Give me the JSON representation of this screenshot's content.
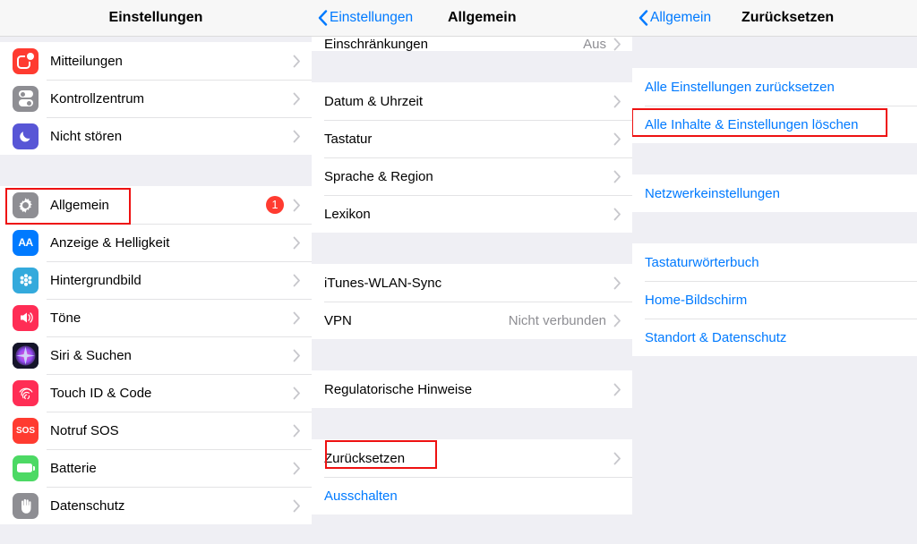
{
  "panels": {
    "settings": {
      "nav": {
        "title": "Einstellungen"
      },
      "groups": [
        {
          "rows": [
            {
              "label": "Mitteilungen",
              "icon": "notifications-icon",
              "chevron": true
            },
            {
              "label": "Kontrollzentrum",
              "icon": "control-center-icon",
              "chevron": true
            },
            {
              "label": "Nicht stören",
              "icon": "do-not-disturb-icon",
              "chevron": true
            }
          ]
        },
        {
          "rows": [
            {
              "label": "Allgemein",
              "icon": "general-gear-icon",
              "badge": "1",
              "chevron": true,
              "highlight": true
            },
            {
              "label": "Anzeige & Helligkeit",
              "icon": "display-brightness-icon",
              "chevron": true
            },
            {
              "label": "Hintergrundbild",
              "icon": "wallpaper-icon",
              "chevron": true
            },
            {
              "label": "Töne",
              "icon": "sounds-icon",
              "chevron": true
            },
            {
              "label": "Siri & Suchen",
              "icon": "siri-icon",
              "chevron": true
            },
            {
              "label": "Touch ID & Code",
              "icon": "touch-id-icon",
              "chevron": true
            },
            {
              "label": "Notruf SOS",
              "icon": "sos-icon",
              "chevron": true
            },
            {
              "label": "Batterie",
              "icon": "battery-icon",
              "chevron": true
            },
            {
              "label": "Datenschutz",
              "icon": "privacy-hand-icon",
              "chevron": true
            }
          ]
        }
      ]
    },
    "general": {
      "nav": {
        "back": "Einstellungen",
        "title": "Allgemein"
      },
      "partial_row": {
        "label": "Einschränkungen",
        "value": "Aus"
      },
      "groups": [
        {
          "rows": [
            {
              "label": "Datum & Uhrzeit",
              "chevron": true
            },
            {
              "label": "Tastatur",
              "chevron": true
            },
            {
              "label": "Sprache & Region",
              "chevron": true
            },
            {
              "label": "Lexikon",
              "chevron": true
            }
          ]
        },
        {
          "rows": [
            {
              "label": "iTunes-WLAN-Sync",
              "chevron": true
            },
            {
              "label": "VPN",
              "value": "Nicht verbunden",
              "chevron": true
            }
          ]
        },
        {
          "rows": [
            {
              "label": "Regulatorische Hinweise",
              "chevron": true
            }
          ]
        },
        {
          "rows": [
            {
              "label": "Zurücksetzen",
              "chevron": true,
              "highlight": true
            },
            {
              "label": "Ausschalten",
              "blue": true
            }
          ]
        }
      ]
    },
    "reset": {
      "nav": {
        "back": "Allgemein",
        "title": "Zurücksetzen"
      },
      "groups": [
        {
          "rows": [
            {
              "label": "Alle Einstellungen zurücksetzen",
              "blue": true
            },
            {
              "label": "Alle Inhalte & Einstellungen löschen",
              "blue": true,
              "highlight": true
            }
          ]
        },
        {
          "rows": [
            {
              "label": "Netzwerkeinstellungen",
              "blue": true
            }
          ]
        },
        {
          "rows": [
            {
              "label": "Tastaturwörterbuch",
              "blue": true
            },
            {
              "label": "Home-Bildschirm",
              "blue": true
            },
            {
              "label": "Standort & Datenschutz",
              "blue": true
            }
          ]
        }
      ]
    }
  },
  "colors": {
    "accent_blue": "#007aff",
    "highlight_red": "#ee1111",
    "badge_red": "#ff3b30",
    "background": "#efeff4",
    "row_background": "#ffffff"
  }
}
